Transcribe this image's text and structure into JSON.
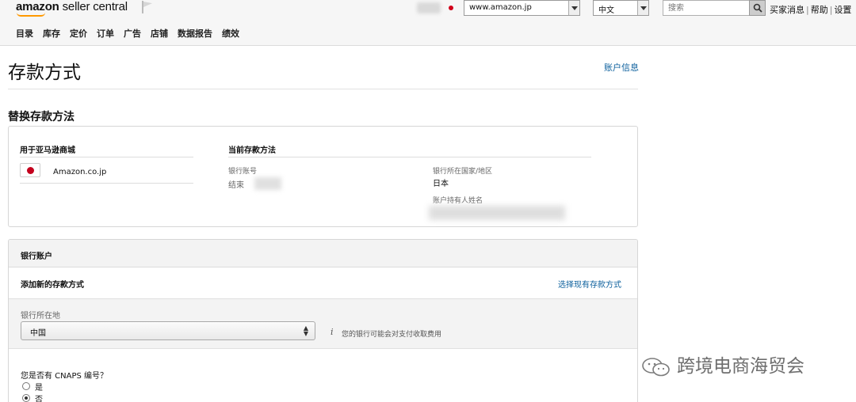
{
  "header": {
    "logo_amazon": "amazon",
    "logo_seller_central": "seller central",
    "marketplace": "www.amazon.jp",
    "language": "中文",
    "search_placeholder": "搜索",
    "links": [
      "买家消息",
      "帮助",
      "设置"
    ]
  },
  "nav": [
    "目录",
    "库存",
    "定价",
    "订单",
    "广告",
    "店铺",
    "数据报告",
    "绩效"
  ],
  "page": {
    "title": "存款方式",
    "account_info_link": "账户信息",
    "section_title": "替换存款方法"
  },
  "current_method": {
    "for_amazon_store_label": "用于亚马逊商城",
    "store": "Amazon.co.jp",
    "current_label": "当前存款方法",
    "bank_account_label": "银行账号",
    "bank_account_value": "结束",
    "bank_country_label": "银行所在国家/地区",
    "bank_country_value": "日本",
    "holder_name_label": "账户持有人姓名"
  },
  "bank_panel": {
    "title": "银行账户",
    "add_new": "添加新的存款方式",
    "choose_existing": "选择现有存款方式",
    "bank_location_label": "银行所在地",
    "bank_location_value": "中国",
    "fee_note": "您的银行可能会对支付收取费用",
    "cnaps_question": "您是否有 CNAPS 编号？",
    "options": [
      {
        "label": "是",
        "selected": false
      },
      {
        "label": "否",
        "selected": true
      }
    ]
  },
  "watermark": "跨境电商海贸会",
  "colors": {
    "link": "#0b5f9c",
    "logo_smile": "#ff9900",
    "jp_red": "#c4001d"
  }
}
